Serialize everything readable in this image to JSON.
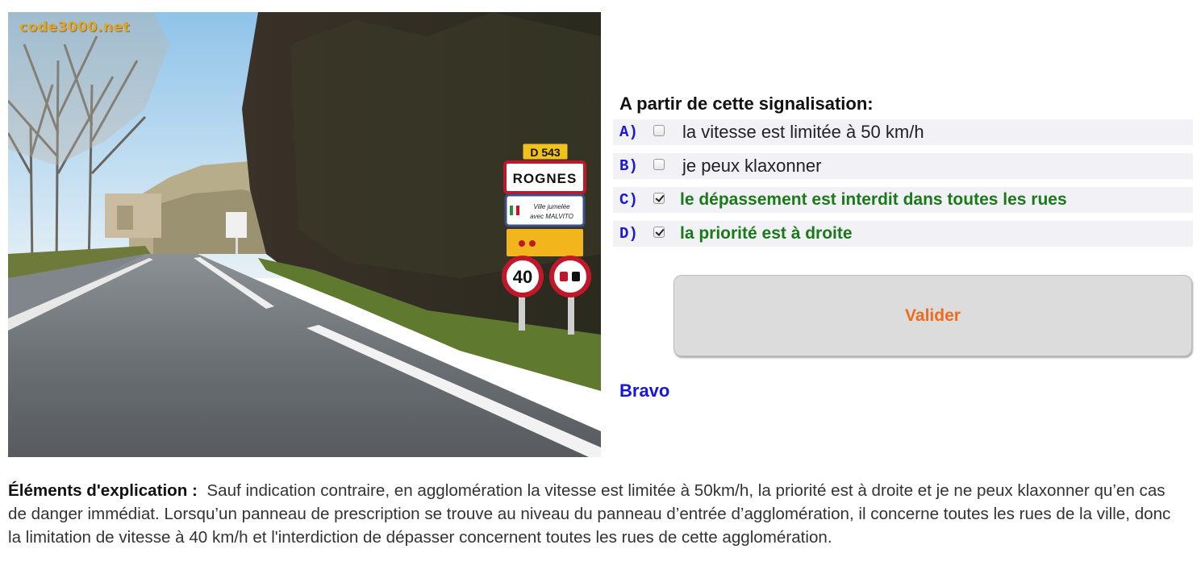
{
  "photo": {
    "watermark": "code3000.net",
    "signs": {
      "route": "D 543",
      "town": "ROGNES",
      "twin_line1": "Ville jumelée",
      "twin_line2": "avec MALVITO",
      "speed": "40"
    }
  },
  "question": "A partir de cette signalisation:",
  "answers": [
    {
      "letter": "A)",
      "text": "la vitesse est limitée à 50 km/h",
      "checked": false
    },
    {
      "letter": "B)",
      "text": "je peux klaxonner",
      "checked": false
    },
    {
      "letter": "C)",
      "text": "le dépassement est interdit dans toutes les rues",
      "checked": true
    },
    {
      "letter": "D)",
      "text": "la priorité est à droite",
      "checked": true
    }
  ],
  "submit_label": "Valider",
  "result": "Bravo",
  "explanation": {
    "lead": "Éléments d'explication :",
    "body": "Sauf indication contraire, en agglomération la vitesse est limitée à 50km/h, la priorité est à droite et je ne peux klaxonner qu’en cas de danger immédiat. Lorsqu’un panneau de prescription se trouve au niveau du panneau d’entrée d’agglomération, il concerne toutes les rues de la ville, donc la limitation de vitesse à 40 km/h et l'interdiction de dépasser concernent toutes les rues de cette agglomération."
  },
  "colors": {
    "letter": "#1a1ad6",
    "correct": "#1a7a1a",
    "submit_text": "#f26a1b",
    "result": "#1515e0"
  }
}
